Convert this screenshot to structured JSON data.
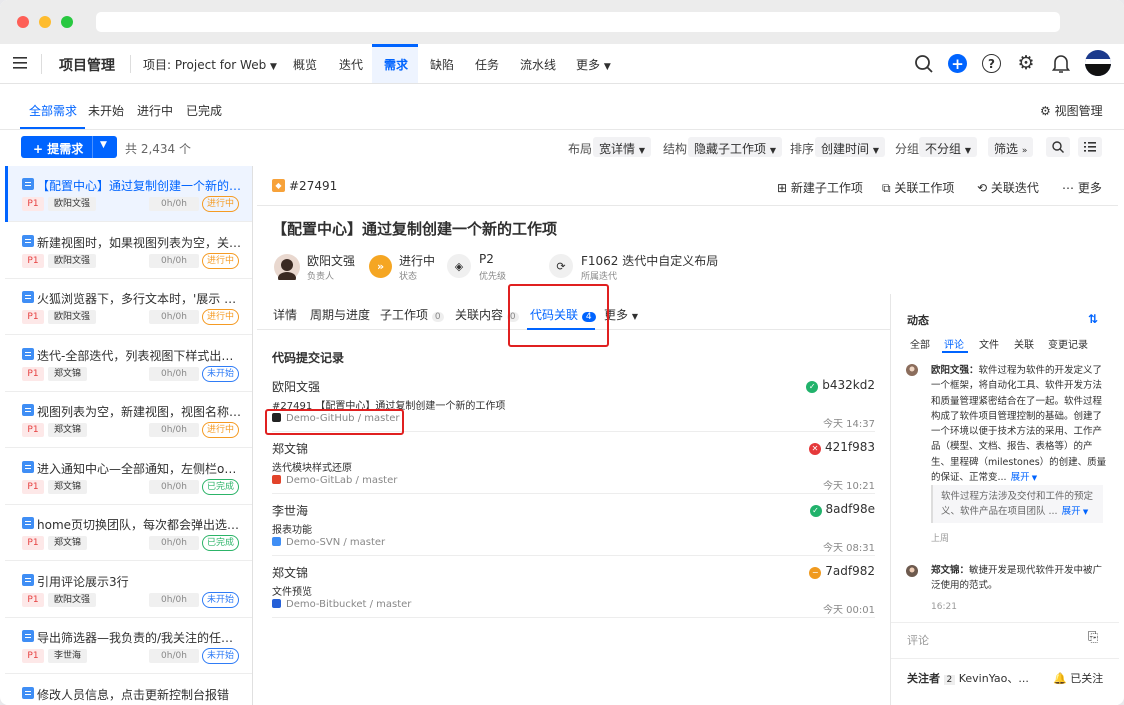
{
  "nav": {
    "title": "项目管理",
    "project": "项目: Project for Web",
    "items": [
      "概览",
      "迭代",
      "需求",
      "缺陷",
      "任务",
      "流水线",
      "更多"
    ]
  },
  "sub": {
    "tabs": [
      "全部需求",
      "未开始",
      "进行中",
      "已完成"
    ],
    "view_manage": "视图管理"
  },
  "toolbar": {
    "add": "+ 提需求",
    "count": "共 2,434 个",
    "layout_label": "布局",
    "layout_value": "宽详情",
    "structure_label": "结构",
    "structure_value": "隐藏子工作项",
    "sort_label": "排序",
    "sort_value": "创建时间",
    "group_label": "分组",
    "group_value": "不分组",
    "filter": "筛选"
  },
  "list": [
    {
      "title": "【配置中心】通过复制创建一个新的工作项",
      "owner": "欧阳文强",
      "time": "0h/0h",
      "status": "进行中",
      "kind": "doing"
    },
    {
      "title": "新建视图时，如果视图列表为空，关闭视图",
      "owner": "欧阳文强",
      "time": "0h/0h",
      "status": "进行中",
      "kind": "doing"
    },
    {
      "title": "火狐浏览器下，多行文本时，'展示 按钮'",
      "owner": "欧阳文强",
      "time": "0h/0h",
      "status": "进行中",
      "kind": "doing"
    },
    {
      "title": "迭代-全部迭代，列表视图下样式出现问题",
      "owner": "郑文锦",
      "time": "0h/0h",
      "status": "未开始",
      "kind": "todo"
    },
    {
      "title": "视图列表为空，新建视图，视图名称显示",
      "owner": "郑文锦",
      "time": "0h/0h",
      "status": "进行中",
      "kind": "doing"
    },
    {
      "title": "进入通知中心—全部通知，左侧栏ones图标",
      "owner": "郑文锦",
      "time": "0h/0h",
      "status": "已完成",
      "kind": "done"
    },
    {
      "title": "home页切换团队，每次都会弹出选择框",
      "owner": "郑文锦",
      "time": "0h/0h",
      "status": "已完成",
      "kind": "done"
    },
    {
      "title": "引用评论展示3行",
      "owner": "欧阳文强",
      "time": "0h/0h",
      "status": "未开始",
      "kind": "todo"
    },
    {
      "title": "导出筛选器—我负责的/我关注的任务列表",
      "owner": "李世海",
      "time": "0h/0h",
      "status": "未开始",
      "kind": "todo"
    },
    {
      "title": "修改人员信息，点击更新控制台报错",
      "owner": "",
      "time": "",
      "status": "",
      "kind": "todo"
    }
  ],
  "priority": "P1",
  "detail": {
    "id": "#27491",
    "actions": [
      "新建子工作项",
      "关联工作项",
      "关联迭代",
      "更多"
    ],
    "title": "【配置中心】通过复制创建一个新的工作项",
    "meta": [
      {
        "value": "欧阳文强",
        "label": "负责人"
      },
      {
        "value": "进行中",
        "label": "状态"
      },
      {
        "value": "P2",
        "label": "优先级"
      },
      {
        "value": "F1062 迭代中自定义布局",
        "label": "所属迭代"
      }
    ],
    "tabs": [
      "详情",
      "周期与进度",
      "子工作项",
      "关联内容",
      "代码关联",
      "更多"
    ],
    "tab_counts": {
      "sub": "0",
      "rel": "0",
      "code": "4"
    },
    "section_title": "代码提交记录",
    "commits": [
      {
        "name": "欧阳文强",
        "msg": "#27491 【配置中心】通过复制创建一个新的工作项",
        "repo": "Demo-GitHub / master",
        "hash": "b432kd2",
        "time": "今天 14:37",
        "status": "ok",
        "status_color": "#21b26b",
        "icon_color": "#222222"
      },
      {
        "name": "郑文锦",
        "msg": "迭代模块样式还原",
        "repo": "Demo-GitLab / master",
        "hash": "421f983",
        "time": "今天 10:21",
        "status": "fail",
        "status_color": "#e5393b",
        "icon_color": "#e2432a"
      },
      {
        "name": "李世海",
        "msg": "报表功能",
        "repo": "Demo-SVN / master",
        "hash": "8adf98e",
        "time": "今天 08:31",
        "status": "ok",
        "status_color": "#21b26b",
        "icon_color": "#3f8ef5"
      },
      {
        "name": "郑文锦",
        "msg": "文件预览",
        "repo": "Demo-Bitbucket / master",
        "hash": "7adf982",
        "time": "今天 00:01",
        "status": "warn",
        "status_color": "#f09a1f",
        "icon_color": "#2560d8"
      }
    ]
  },
  "activity": {
    "title": "动态",
    "tabs": [
      "全部",
      "评论",
      "文件",
      "关联",
      "变更记录"
    ],
    "c1_author": "欧阳文强：",
    "c1_lines": [
      "软件过程为软件的开发定义了",
      "一个框架，将自动化工具、软件开发方法",
      "和质量管理紧密结合在了一起。软件过程",
      "构成了软件项目管理控制的基础。创建了",
      "一个环境以便于技术方法的采用、工作产",
      "品（模型、文档、报告、表格等）的产",
      "生、里程碑（milestones）的创建、质量"
    ],
    "c1_last": "的保证、正常变...",
    "expand": "展开",
    "quote_lines": [
      "软件过程方法涉及交付和工件的预定",
      "义、软件产品在项目团队 ..."
    ],
    "c1_time": "上周",
    "c2_author": "郑文锦：",
    "c2_lines": [
      "敏捷开发是现代软件开发中被广",
      "泛使用的范式。"
    ],
    "c2_time": "16:21",
    "comment_placeholder": "评论",
    "watchers_label": "关注者",
    "watchers_count": "2",
    "watchers": "KevinYao、...",
    "followed": "已关注"
  }
}
